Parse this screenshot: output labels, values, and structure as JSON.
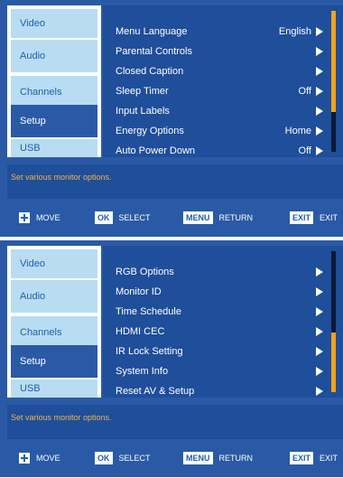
{
  "screen1": {
    "tabs": [
      "Video",
      "Audio",
      "Channels",
      "Setup",
      "USB"
    ],
    "selected_tab": "Setup",
    "items": [
      {
        "label": "Menu Language",
        "value": "English"
      },
      {
        "label": "Parental Controls",
        "value": ""
      },
      {
        "label": "Closed Caption",
        "value": ""
      },
      {
        "label": "Sleep Timer",
        "value": "Off"
      },
      {
        "label": "Input Labels",
        "value": ""
      },
      {
        "label": "Energy Options",
        "value": "Home"
      },
      {
        "label": "Auto Power Down",
        "value": "Off"
      }
    ],
    "help": "Set various monitor options."
  },
  "screen2": {
    "tabs": [
      "Video",
      "Audio",
      "Channels",
      "Setup",
      "USB"
    ],
    "selected_tab": "Setup",
    "items": [
      {
        "label": "RGB Options",
        "value": ""
      },
      {
        "label": "Monitor ID",
        "value": ""
      },
      {
        "label": "Time Schedule",
        "value": ""
      },
      {
        "label": "HDMI CEC",
        "value": ""
      },
      {
        "label": "IR Lock Setting",
        "value": ""
      },
      {
        "label": "System Info",
        "value": ""
      },
      {
        "label": "Reset AV & Setup",
        "value": ""
      }
    ],
    "help": "Set various monitor options."
  },
  "bar": {
    "move": "MOVE",
    "ok_key": "OK",
    "select": "SELECT",
    "menu_key": "MENU",
    "return": "RETURN",
    "exit_key": "EXIT",
    "exit": "EXIT"
  },
  "colors": {
    "accent": "#f5a21e",
    "panel": "#1f4e9a",
    "tab": "#b8dcf2"
  }
}
